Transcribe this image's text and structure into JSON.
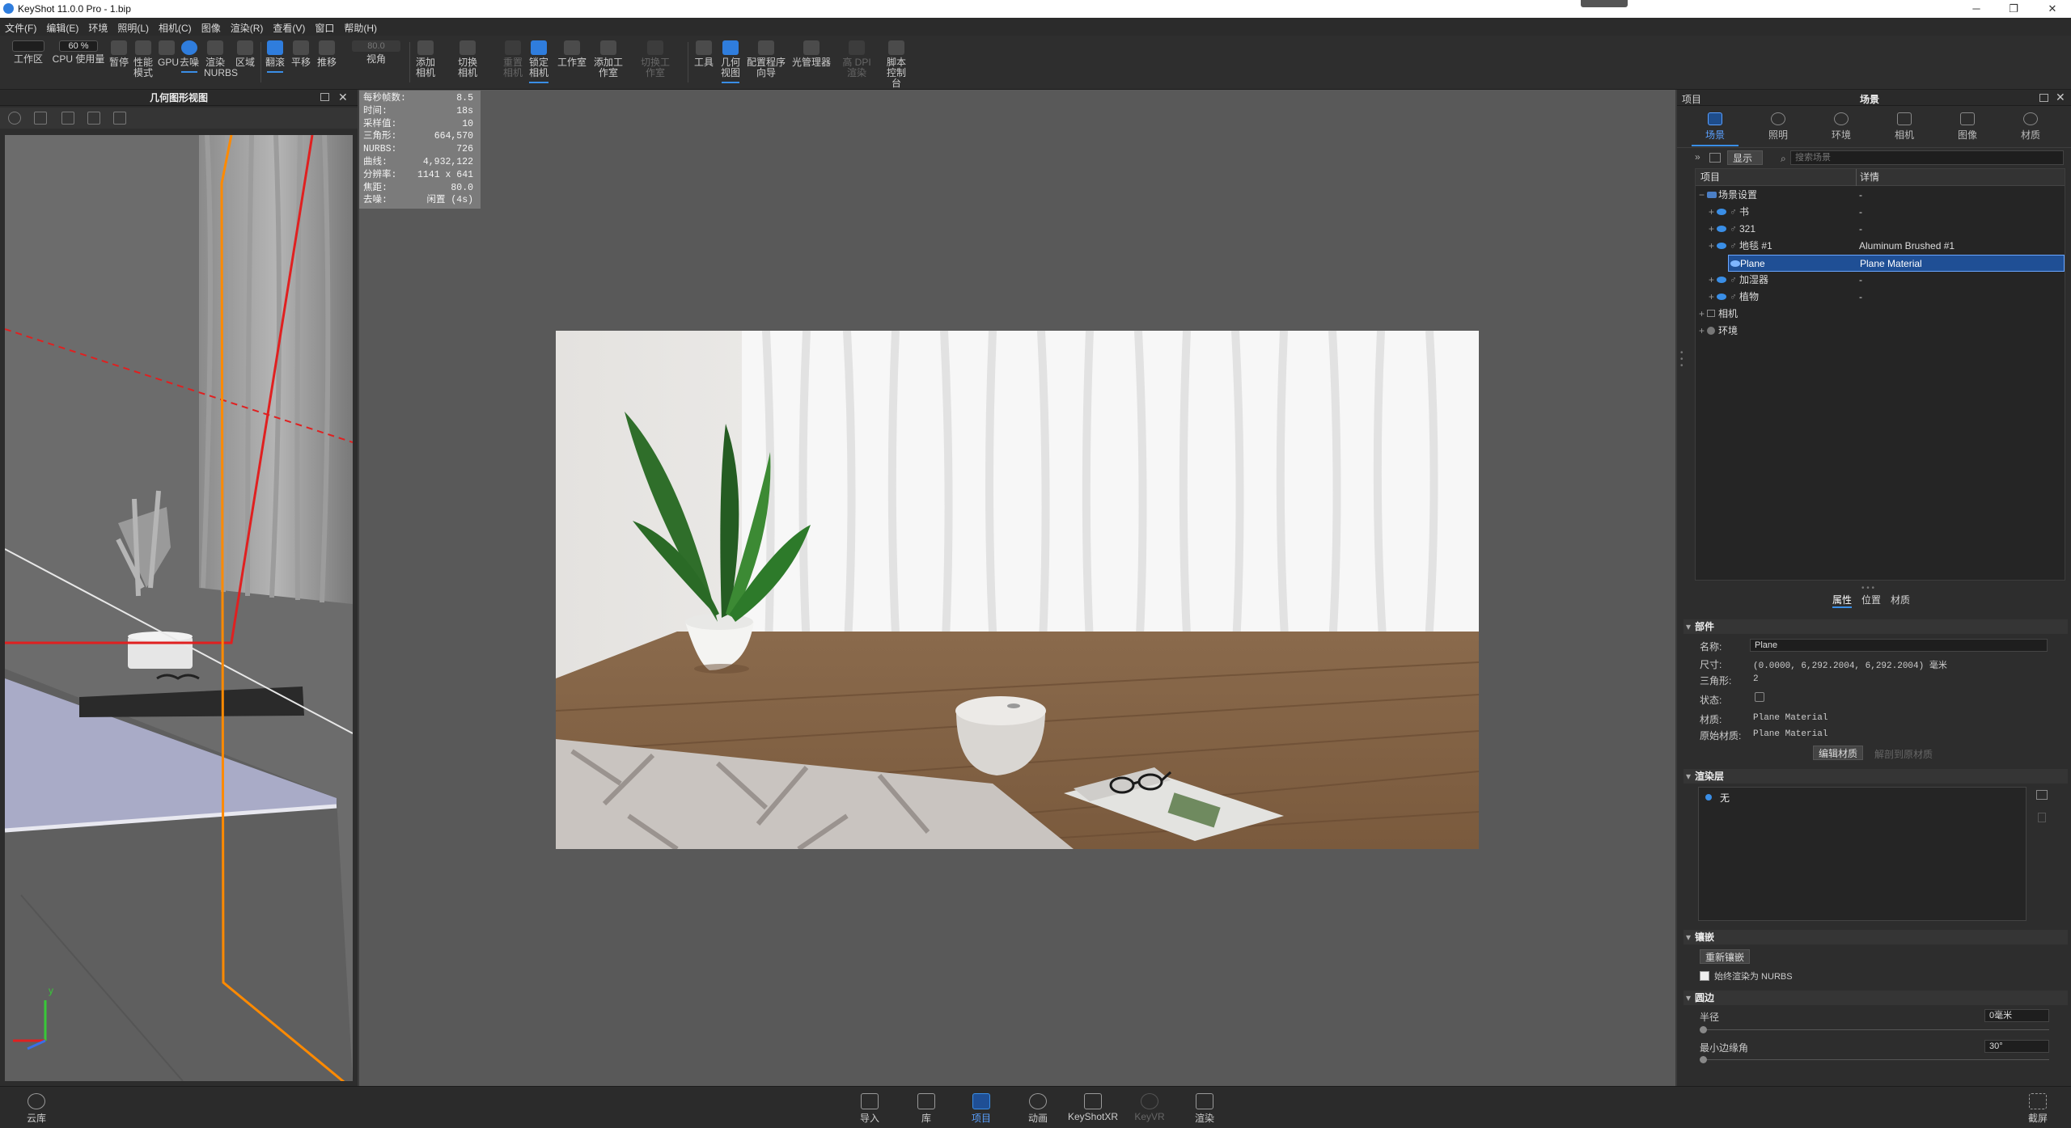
{
  "window": {
    "title": "KeyShot 11.0.0 Pro - 1.bip"
  },
  "menu": [
    "文件(F)",
    "编辑(E)",
    "环境",
    "照明(L)",
    "相机(C)",
    "图像",
    "渲染(R)",
    "查看(V)",
    "窗口",
    "帮助(H)"
  ],
  "toolbar": {
    "zoom_value": "60 %",
    "fov_value": "80.0",
    "items": [
      "工作区",
      "CPU 使用量",
      "暂停",
      "性能模式",
      "GPU",
      "去噪",
      "渲染NURBS",
      "区域",
      "翻滚",
      "平移",
      "推移",
      "视角",
      "添加相机",
      "切换相机",
      "重置相机",
      "锁定相机",
      "工作室",
      "添加工作室",
      "切换工作室",
      "工具",
      "几何视图",
      "配置程序向导",
      "光管理器",
      "高 DPI 渲染",
      "脚本控制台"
    ]
  },
  "geometry_view": {
    "title": "几何图形视图",
    "axis_y": "y"
  },
  "stats": [
    {
      "label": "每秒帧数:",
      "value": "8.5"
    },
    {
      "label": "时间:",
      "value": "18s"
    },
    {
      "label": "采样值:",
      "value": "10"
    },
    {
      "label": "三角形:",
      "value": "664,570"
    },
    {
      "label": "NURBS:",
      "value": "726"
    },
    {
      "label": "曲线:",
      "value": "4,932,122"
    },
    {
      "label": "分辨率:",
      "value": "1141 x 641"
    },
    {
      "label": "焦距:",
      "value": "80.0"
    },
    {
      "label": "去噪:",
      "value": "闲置 (4s)"
    }
  ],
  "project_panel": {
    "header_left": "项目",
    "header_center": "场景",
    "tabs": [
      "场景",
      "照明",
      "环境",
      "相机",
      "图像",
      "材质"
    ],
    "filter_label": "显示",
    "search_placeholder": "搜索场景",
    "columns": [
      "项目",
      "详情"
    ],
    "tree": [
      {
        "name": "场景设置",
        "detail": "-"
      },
      {
        "name": "书",
        "detail": "-"
      },
      {
        "name": "321",
        "detail": "-"
      },
      {
        "name": "地毯 #1",
        "detail": "Aluminum Brushed #1"
      },
      {
        "name": "Plane",
        "detail": "Plane Material"
      },
      {
        "name": "加湿器",
        "detail": "-"
      },
      {
        "name": "植物",
        "detail": "-"
      },
      {
        "name": "相机",
        "detail": ""
      },
      {
        "name": "环境",
        "detail": ""
      }
    ],
    "subtabs": [
      "属性",
      "位置",
      "材质"
    ]
  },
  "properties": {
    "part_section": "部件",
    "name_label": "名称:",
    "name_value": "Plane",
    "size_label": "尺寸:",
    "size_value": "(0.0000, 6,292.2004, 6,292.2004) 毫米",
    "tri_label": "三角形:",
    "tri_value": "2",
    "state_label": "状态:",
    "material_label": "材质:",
    "material_value": "Plane Material",
    "orig_material_label": "原始材质:",
    "orig_material_value": "Plane Material",
    "edit_material_btn": "编辑材质",
    "revert_material_btn": "解剖到原材质",
    "render_layer_section": "渲染层",
    "render_layer_item": "无",
    "tessellation_section": "镶嵌",
    "retessellate_btn": "重新镶嵌",
    "always_nurbs_label": "始终渲染为 NURBS",
    "rounding_section": "圆边",
    "radius_label": "半径",
    "radius_value": "0毫米",
    "min_angle_label": "最小边缘角",
    "min_angle_value": "30°"
  },
  "bottom": {
    "cloud": "云库",
    "items": [
      "导入",
      "库",
      "项目",
      "动画",
      "KeyShotXR",
      "KeyVR",
      "渲染"
    ],
    "screenshot": "截屏"
  },
  "colors": {
    "accent": "#3a8ee6",
    "selection": "#1f4f95",
    "geo_red": "#e02020",
    "geo_orange": "#ff8a00"
  }
}
